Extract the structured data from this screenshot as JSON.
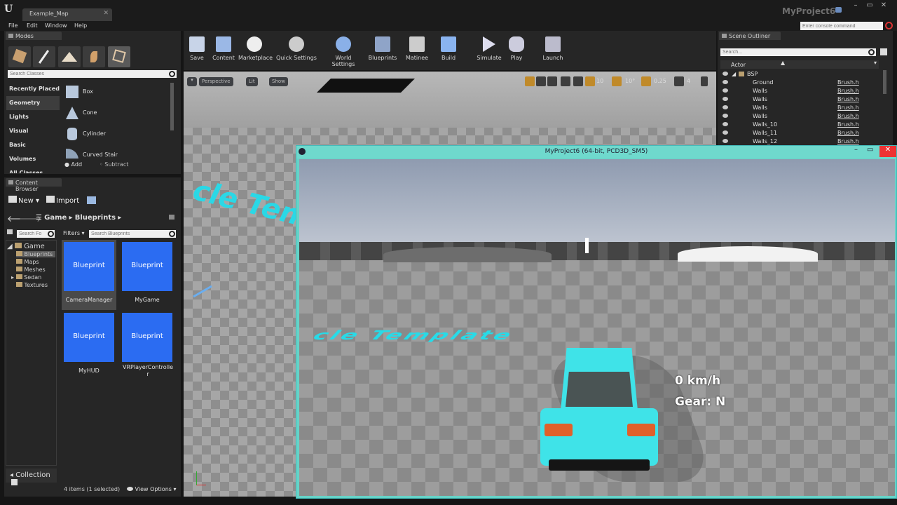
{
  "window": {
    "tab_title": "Example_Map",
    "project_name": "MyProject6",
    "console_placeholder": "Enter console command"
  },
  "menu": [
    "File",
    "Edit",
    "Window",
    "Help"
  ],
  "modes": {
    "tab": "Modes",
    "search_placeholder": "Search Classes",
    "categories": [
      "Recently Placed",
      "Geometry",
      "Lights",
      "Visual",
      "Basic",
      "Volumes",
      "All Classes"
    ],
    "selected_category": "Geometry",
    "shapes": [
      "Box",
      "Cone",
      "Cylinder",
      "Curved Stair"
    ],
    "add_label": "Add",
    "subtract_label": "Subtract"
  },
  "toolbar": [
    "Save",
    "Content",
    "Marketplace",
    "Quick Settings",
    "World Settings",
    "Blueprints",
    "Matinee",
    "Build",
    "Simulate",
    "Play",
    "Launch"
  ],
  "viewport": {
    "perspective": "Perspective",
    "lit": "Lit",
    "show": "Show",
    "grid_snap": "10",
    "rot_snap": "10°",
    "scale_snap": "0.25",
    "cam_speed": "4",
    "floor_text": "cle Template"
  },
  "content_browser": {
    "tab": "Content Browser",
    "new_label": "New",
    "import_label": "Import",
    "breadcrumb": [
      "Game",
      "Blueprints"
    ],
    "folder_search_placeholder": "Search Fo",
    "filters_label": "Filters",
    "search_placeholder": "Search Blueprints",
    "tree": [
      "Game",
      "Blueprints",
      "Maps",
      "Meshes",
      "Sedan",
      "Textures"
    ],
    "assets": [
      {
        "type": "Blueprint",
        "name": "CameraManager"
      },
      {
        "type": "Blueprint",
        "name": "MyGame"
      },
      {
        "type": "Blueprint",
        "name": "MyHUD"
      },
      {
        "type": "Blueprint",
        "name": "VRPlayerControlle\nr"
      }
    ],
    "status": "4 items (1 selected)",
    "view_options": "View Options",
    "collections": "Collection"
  },
  "outliner": {
    "tab": "Scene Outliner",
    "search_placeholder": "Search...",
    "column": "Actor",
    "group": "BSP",
    "rows": [
      {
        "name": "Ground",
        "type": "Brush.h"
      },
      {
        "name": "Walls",
        "type": "Brush.h"
      },
      {
        "name": "Walls",
        "type": "Brush.h"
      },
      {
        "name": "Walls",
        "type": "Brush.h"
      },
      {
        "name": "Walls",
        "type": "Brush.h"
      },
      {
        "name": "Walls_10",
        "type": "Brush.h"
      },
      {
        "name": "Walls_11",
        "type": "Brush.h"
      },
      {
        "name": "Walls_12",
        "type": "Brush.h"
      }
    ]
  },
  "game_window": {
    "title": "MyProject6 (64-bit, PCD3D_SM5)",
    "speed": "0 km/h",
    "gear": "Gear: N",
    "floor_text": "cle Template"
  },
  "colors": {
    "accent": "#2b6cf2",
    "game_frame": "#66d3c8",
    "car": "#3fe3e8",
    "floor_text": "#27dbe8"
  }
}
